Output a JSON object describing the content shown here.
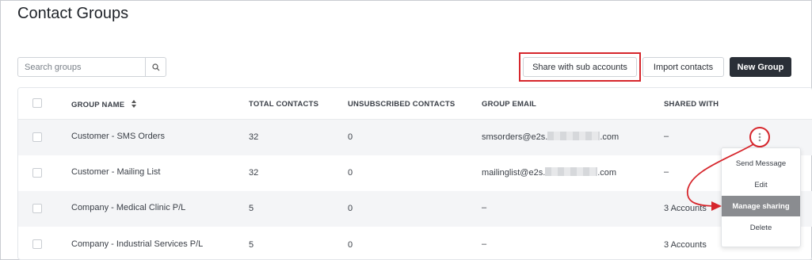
{
  "page": {
    "title": "Contact Groups"
  },
  "search": {
    "placeholder": "Search groups"
  },
  "toolbar": {
    "share_label": "Share with sub accounts",
    "import_label": "Import contacts",
    "new_group_label": "New Group"
  },
  "table": {
    "headers": {
      "group_name": "GROUP NAME",
      "total_contacts": "TOTAL CONTACTS",
      "unsubscribed_contacts": "UNSUBSCRIBED CONTACTS",
      "group_email": "GROUP EMAIL",
      "shared_with": "SHARED WITH"
    },
    "rows": [
      {
        "name": "Customer - SMS Orders",
        "total": "32",
        "unsubscribed": "0",
        "email_prefix": "smsorders@e2s.",
        "email_suffix": ".com",
        "shared": "–"
      },
      {
        "name": "Customer - Mailing List",
        "total": "32",
        "unsubscribed": "0",
        "email_prefix": "mailinglist@e2s.",
        "email_suffix": ".com",
        "shared": "–"
      },
      {
        "name": "Company - Medical Clinic P/L",
        "total": "5",
        "unsubscribed": "0",
        "email_prefix": "–",
        "email_suffix": "",
        "shared": "3 Accounts"
      },
      {
        "name": "Company - Industrial Services P/L",
        "total": "5",
        "unsubscribed": "0",
        "email_prefix": "–",
        "email_suffix": "",
        "shared": "3 Accounts"
      }
    ]
  },
  "row_menu": {
    "items": [
      "Send Message",
      "Edit",
      "Manage sharing",
      "Delete"
    ],
    "active_item": "Manage sharing"
  },
  "colors": {
    "accent_dark": "#2a2f37",
    "highlight_red": "#d6262c",
    "menu_active": "#8a8c90"
  },
  "icons": {
    "search": "search-icon",
    "sort": "sort-icon",
    "row_actions": "kebab-icon"
  }
}
